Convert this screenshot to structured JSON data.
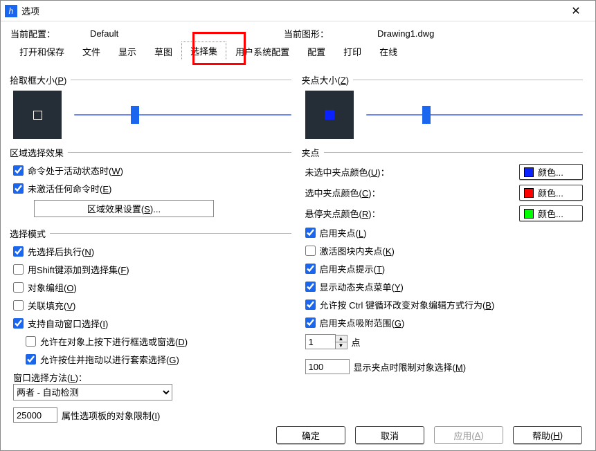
{
  "window": {
    "title": "选项",
    "icon_glyph": "h",
    "close": "✕"
  },
  "config": {
    "current_config_label": "当前配置：",
    "current_config_value": "Default",
    "current_drawing_label": "当前图形：",
    "current_drawing_value": "Drawing1.dwg"
  },
  "tabs": {
    "t0": "打开和保存",
    "t1": "文件",
    "t2": "显示",
    "t3": "草图",
    "t4": "选择集",
    "t5": "用户系统配置",
    "t6": "配置",
    "t7": "打印",
    "t8": "在线"
  },
  "left": {
    "pickbox": {
      "legend_pre": "拾取框大小(",
      "legend_key": "P",
      "legend_post": ")"
    },
    "region": {
      "legend": "区域选择效果",
      "active_pre": "命令处于活动状态时(",
      "active_key": "W",
      "active_post": ")",
      "inactive_pre": "未激活任何命令时(",
      "inactive_key": "E",
      "inactive_post": ")",
      "settings_pre": "区域效果设置(",
      "settings_key": "S",
      "settings_post": ")..."
    },
    "mode": {
      "legend": "选择模式",
      "noun_pre": "先选择后执行(",
      "noun_key": "N",
      "noun_post": ")",
      "shift_pre": "用Shift键添加到选择集(",
      "shift_key": "F",
      "shift_post": ")",
      "group_pre": "对象编组(",
      "group_key": "O",
      "group_post": ")",
      "hatch_pre": "关联填充(",
      "hatch_key": "V",
      "hatch_post": ")",
      "implied_pre": "支持自动窗口选择(",
      "implied_key": "I",
      "implied_post": ")",
      "drag_pre": "允许在对象上按下进行框选或窗选(",
      "drag_key": "D",
      "drag_post": ")",
      "lasso_pre": "允许按住并拖动以进行套索选择(",
      "lasso_key": "G",
      "lasso_post": ")",
      "method_pre": "窗口选择方法(",
      "method_key": "L",
      "method_post": ")：",
      "method_value": "两者 - 自动检测",
      "limit_value": "25000",
      "limit_pre": "属性选项板的对象限制(",
      "limit_key": "I",
      "limit_post": ")"
    }
  },
  "right": {
    "gripsize": {
      "legend_pre": "夹点大小(",
      "legend_key": "Z",
      "legend_post": ")"
    },
    "grips": {
      "legend": "夹点",
      "unsel_pre": "未选中夹点颜色(",
      "unsel_key": "U",
      "unsel_post": ")：",
      "sel_pre": "选中夹点颜色(",
      "sel_key": "C",
      "sel_post": ")：",
      "hover_pre": "悬停夹点颜色(",
      "hover_key": "R",
      "hover_post": ")：",
      "colorbtn": "颜色...",
      "unsel_color": "#0922ff",
      "sel_color": "#ff0000",
      "hover_color": "#00ff00",
      "enable_pre": "启用夹点(",
      "enable_key": "L",
      "enable_post": ")",
      "block_pre": "激活图块内夹点(",
      "block_key": "K",
      "block_post": ")",
      "tips_pre": "启用夹点提示(",
      "tips_key": "T",
      "tips_post": ")",
      "dyn_pre": "显示动态夹点菜单(",
      "dyn_key": "Y",
      "dyn_post": ")",
      "ctrl_pre": "允许按 Ctrl 键循环改变对象编辑方式行为(",
      "ctrl_key": "B",
      "ctrl_post": ")",
      "snap_pre": "启用夹点吸附范围(",
      "snap_key": "G",
      "snap_post": ")",
      "snap_value": "1",
      "snap_unit": "点",
      "limit_value": "100",
      "limit_pre": "显示夹点时限制对象选择(",
      "limit_key": "M",
      "limit_post": ")"
    }
  },
  "buttons": {
    "ok": "确定",
    "cancel": "取消",
    "apply_pre": "应用(",
    "apply_key": "A",
    "apply_post": ")",
    "help_pre": "帮助(",
    "help_key": "H",
    "help_post": ")"
  }
}
